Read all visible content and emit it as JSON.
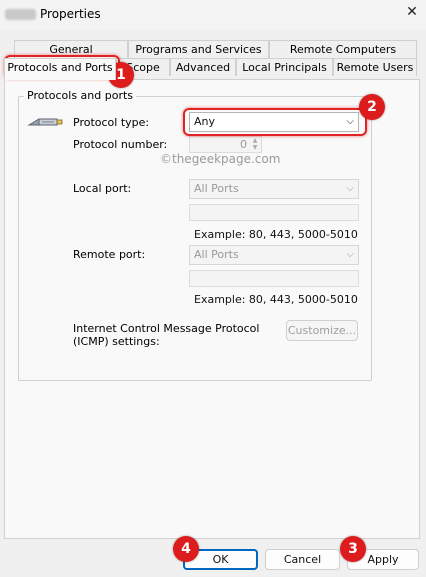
{
  "window": {
    "title": "Properties",
    "close_glyph": "✕"
  },
  "tabs": {
    "row1": [
      {
        "label": "General"
      },
      {
        "label": "Programs and Services"
      },
      {
        "label": "Remote Computers"
      }
    ],
    "row2": [
      {
        "label": "Protocols and Ports",
        "active": true
      },
      {
        "label": "Scope"
      },
      {
        "label": "Advanced"
      },
      {
        "label": "Local Principals"
      },
      {
        "label": "Remote Users"
      }
    ]
  },
  "group": {
    "label": "Protocols and ports",
    "icon": "network-cable-icon"
  },
  "protocol_type": {
    "label": "Protocol type:",
    "value": "Any"
  },
  "protocol_number": {
    "label": "Protocol number:",
    "value": "0"
  },
  "watermark": "©thegeekpage.com",
  "local_port": {
    "label": "Local port:",
    "value": "All Ports",
    "example": "Example: 80, 443, 5000-5010"
  },
  "remote_port": {
    "label": "Remote port:",
    "value": "All Ports",
    "example": "Example: 80, 443, 5000-5010"
  },
  "icmp": {
    "label_line1": "Internet Control Message Protocol",
    "label_line2": "(ICMP) settings:",
    "button": "Customize..."
  },
  "footer": {
    "ok": "OK",
    "cancel": "Cancel",
    "apply": "Apply"
  },
  "callouts": [
    "1",
    "2",
    "3",
    "4"
  ],
  "colors": {
    "callout_red": "#dd1d1d",
    "ok_border": "#0067c0"
  }
}
